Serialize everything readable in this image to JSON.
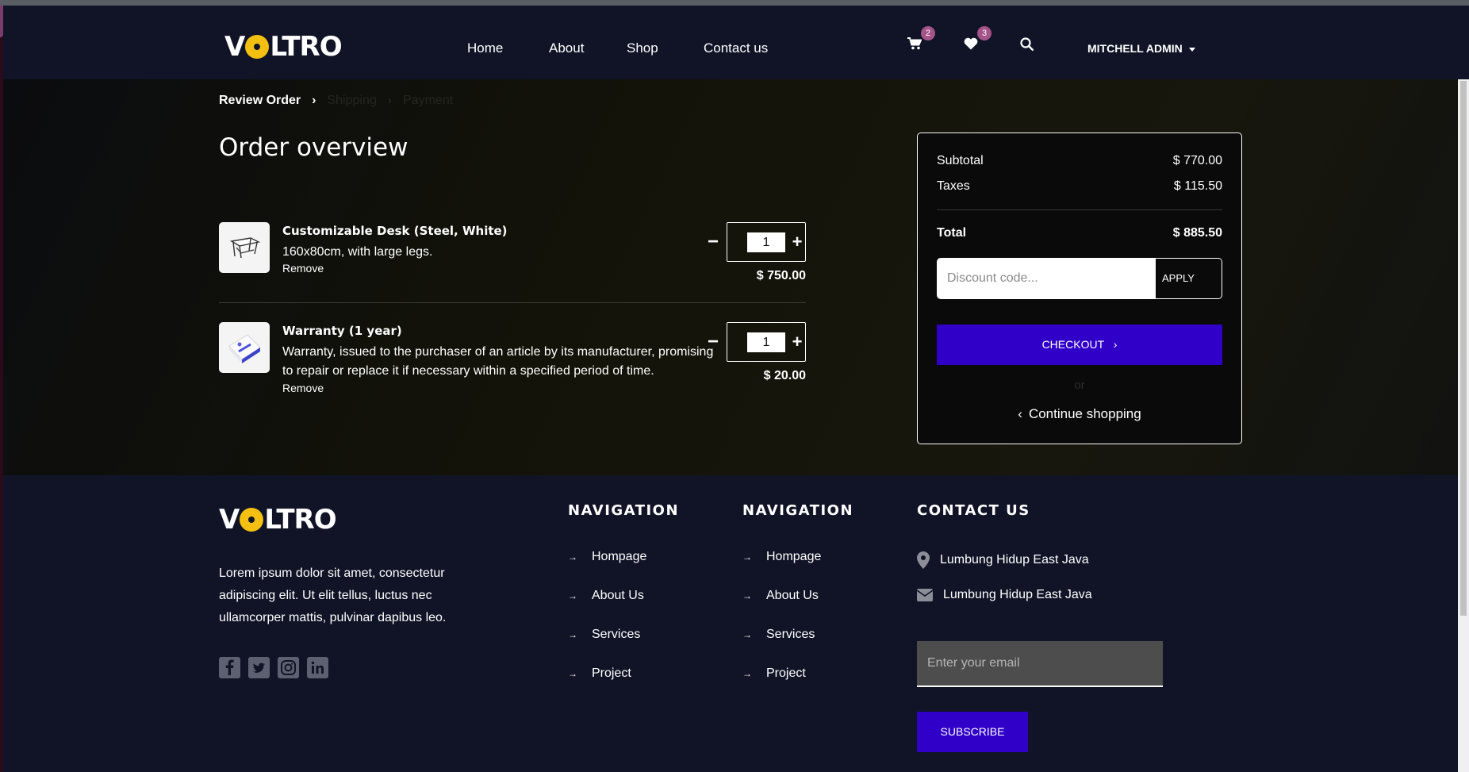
{
  "brand": {
    "logo_pre": "V",
    "logo_post": "LTRO"
  },
  "header": {
    "nav": [
      "Home",
      "About",
      "Shop",
      "Contact us"
    ],
    "cart_count": "2",
    "wishlist_count": "3",
    "user_name": "MITCHELL ADMIN"
  },
  "breadcrumb": {
    "step1": "Review Order",
    "step2": "Shipping",
    "step3": "Payment"
  },
  "page_title": "Order overview",
  "items": [
    {
      "name": "Customizable Desk (Steel, White)",
      "description": "160x80cm, with large legs.",
      "remove": "Remove",
      "quantity": "1",
      "price": "$ 750.00",
      "icon": "desk-icon"
    },
    {
      "name": "Warranty (1 year)",
      "description": "Warranty, issued to the purchaser of an article by its manufacturer, promising to repair or replace it if necessary within a specified period of time.",
      "remove": "Remove",
      "quantity": "1",
      "price": "$ 20.00",
      "icon": "warranty-box-icon"
    }
  ],
  "summary": {
    "subtotal_label": "Subtotal",
    "subtotal_value": "$ 770.00",
    "taxes_label": "Taxes",
    "taxes_value": "$ 115.50",
    "total_label": "Total",
    "total_value": "$ 885.50",
    "discount_placeholder": "Discount code...",
    "apply_label": "APPLY",
    "checkout_label": "CHECKOUT",
    "or_label": "or",
    "continue_label": "Continue shopping"
  },
  "footer": {
    "about_text": "Lorem ipsum dolor sit amet, consectetur adipiscing elit. Ut elit tellus, luctus nec ullamcorper mattis, pulvinar dapibus leo.",
    "socials": [
      "facebook-icon",
      "twitter-icon",
      "instagram-icon",
      "linkedin-icon"
    ],
    "nav1_title": "NAVIGATION",
    "nav1_items": [
      "Hompage",
      "About Us",
      "Services",
      "Project"
    ],
    "nav2_title": "NAVIGATION",
    "nav2_items": [
      "Hompage",
      "About Us",
      "Services",
      "Project"
    ],
    "contact_title": "CONTACT US",
    "address": "Lumbung Hidup East Java",
    "email": "Lumbung Hidup East Java",
    "email_placeholder": "Enter your email",
    "subscribe_label": "SUBSCRIBE"
  },
  "colors": {
    "accent": "#3000c8",
    "logo_yellow": "#f3c012",
    "badge": "#a4548a",
    "navy": "#111427"
  }
}
